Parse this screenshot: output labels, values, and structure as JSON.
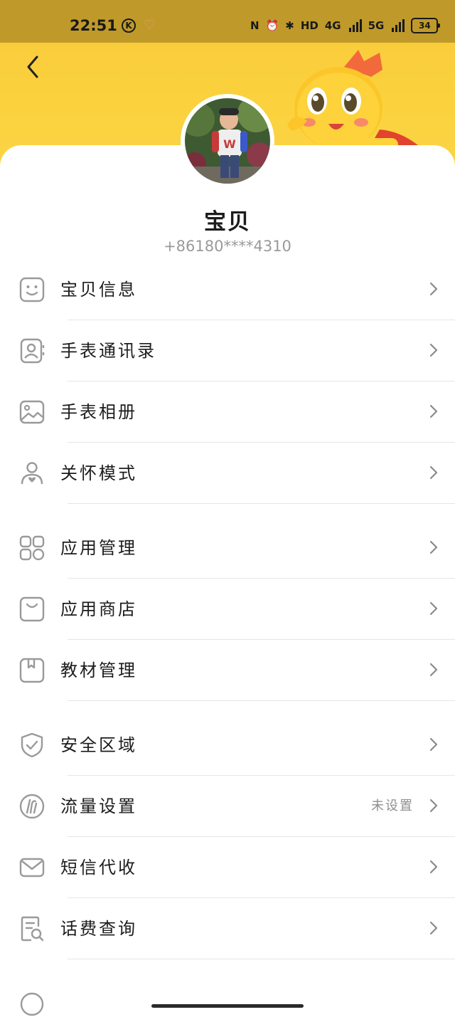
{
  "status_bar": {
    "time": "22:51",
    "k_badge": "K",
    "hd_label": "HD",
    "net1": "4G",
    "net2": "5G",
    "battery": "34"
  },
  "profile": {
    "name": "宝贝",
    "phone": "+86180****4310"
  },
  "menu_groups": [
    {
      "items": [
        {
          "label": "宝贝信息",
          "icon": "smiley-face-icon"
        },
        {
          "label": "手表通讯录",
          "icon": "contacts-card-icon"
        },
        {
          "label": "手表相册",
          "icon": "photo-album-icon"
        },
        {
          "label": "关怀模式",
          "icon": "care-mode-icon"
        }
      ]
    },
    {
      "items": [
        {
          "label": "应用管理",
          "icon": "apps-grid-icon"
        },
        {
          "label": "应用商店",
          "icon": "shopping-bag-icon"
        },
        {
          "label": "教材管理",
          "icon": "textbook-icon"
        }
      ]
    },
    {
      "items": [
        {
          "label": "安全区域",
          "icon": "shield-check-icon"
        },
        {
          "label": "流量设置",
          "icon": "data-traffic-icon",
          "value": "未设置"
        },
        {
          "label": "短信代收",
          "icon": "envelope-icon"
        },
        {
          "label": "话费查询",
          "icon": "bill-search-icon"
        }
      ]
    }
  ],
  "colors": {
    "header_yellow": "#fbd23e",
    "status_bar": "#bf9a2a",
    "icon_gray": "#9a9a9a",
    "divider": "#e6e6e6",
    "page_bg": "#f2f2f2"
  }
}
